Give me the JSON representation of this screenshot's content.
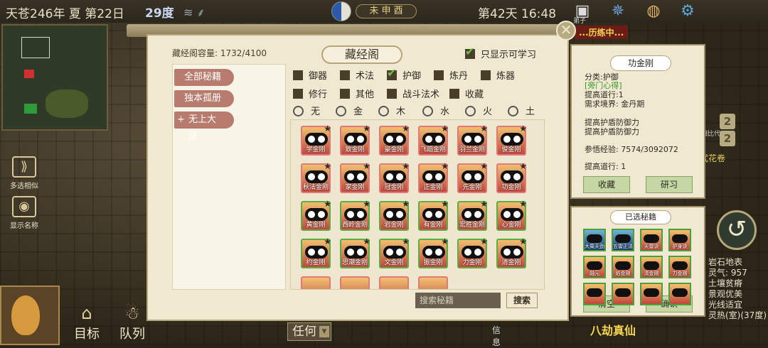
{
  "topbar": {
    "date": "天苍246年 夏 第22日",
    "temperature": "29度",
    "weather_icon": "wind-icon",
    "hours": "未 申 酉",
    "day_time": "第42天 16:48",
    "sub_label": "弟子"
  },
  "left_buttons": {
    "multi_select": "多选相似",
    "show_names": "显示名称"
  },
  "bottom": {
    "target": "目标",
    "team": "队列",
    "select_value": "任何",
    "info": "信息"
  },
  "mission": "...历练中...",
  "side_numbers": [
    "2",
    "2"
  ],
  "side_label": "神武花卷",
  "side_chip": "相比代",
  "env": {
    "lines": [
      "岩石地表",
      "灵气: 957",
      "土壤贫瘠",
      "景观优美",
      "光线适宜",
      "灵热(室)(37度)"
    ]
  },
  "bagua": "八劫真仙",
  "dialog": {
    "capacity": "藏经阁容量: 1732/4100",
    "title": "藏经阁",
    "only_learnable": "只显示可学习",
    "categories": [
      "全部秘籍",
      "独本孤册",
      "无上大法"
    ],
    "types_row1": [
      {
        "label": "御器",
        "checked": false
      },
      {
        "label": "术法",
        "checked": false
      },
      {
        "label": "护御",
        "checked": true
      },
      {
        "label": "炼丹",
        "checked": false
      },
      {
        "label": "炼器",
        "checked": false
      }
    ],
    "types_row2": [
      {
        "label": "修行",
        "checked": false
      },
      {
        "label": "其他",
        "checked": false
      },
      {
        "label": "战斗法术",
        "checked": false
      },
      {
        "label": "收藏",
        "checked": false
      }
    ],
    "elements": [
      "无",
      "金",
      "木",
      "水",
      "火",
      "土"
    ],
    "books": [
      [
        "学金刚",
        "致金刚",
        "豪金刚",
        "飞蹈金刚",
        "羽兰金刚",
        "俊金刚"
      ],
      [
        "秋法金刚",
        "家金刚",
        "冠金刚",
        "正金刚",
        "先金刚",
        "功金刚"
      ],
      [
        "黄金刚",
        "西岭金刚",
        "岩金刚",
        "有金刚",
        "宏胜金刚",
        "心金刚"
      ],
      [
        "约金刚",
        "思潮金刚",
        "文金刚",
        "振金刚",
        "力金刚",
        "清金刚"
      ]
    ],
    "search_placeholder": "搜索秘籍",
    "search_button": "搜索"
  },
  "detail": {
    "title": "功金刚",
    "category": "分类:护御",
    "tag": "[旁门心得]",
    "req_daoxing": "提高道行:1",
    "req_realm": "需求境界: 金丹期",
    "effect1": "提高护盾防御力",
    "effect2": "提高护盾防御力",
    "exp": "参悟经验: 7574/3092072",
    "daoxing": "提高道行: 1",
    "btn_collect": "收藏",
    "btn_study": "研习"
  },
  "selected": {
    "title": "已选秘籍",
    "items": [
      "大周天劲",
      "五雷正法",
      "天雷诀",
      "护身诀",
      "融元",
      "焰金刚",
      "清金刚",
      "力金刚",
      "",
      "",
      "",
      ""
    ],
    "btn_clear": "清空",
    "btn_confirm": "确认"
  }
}
